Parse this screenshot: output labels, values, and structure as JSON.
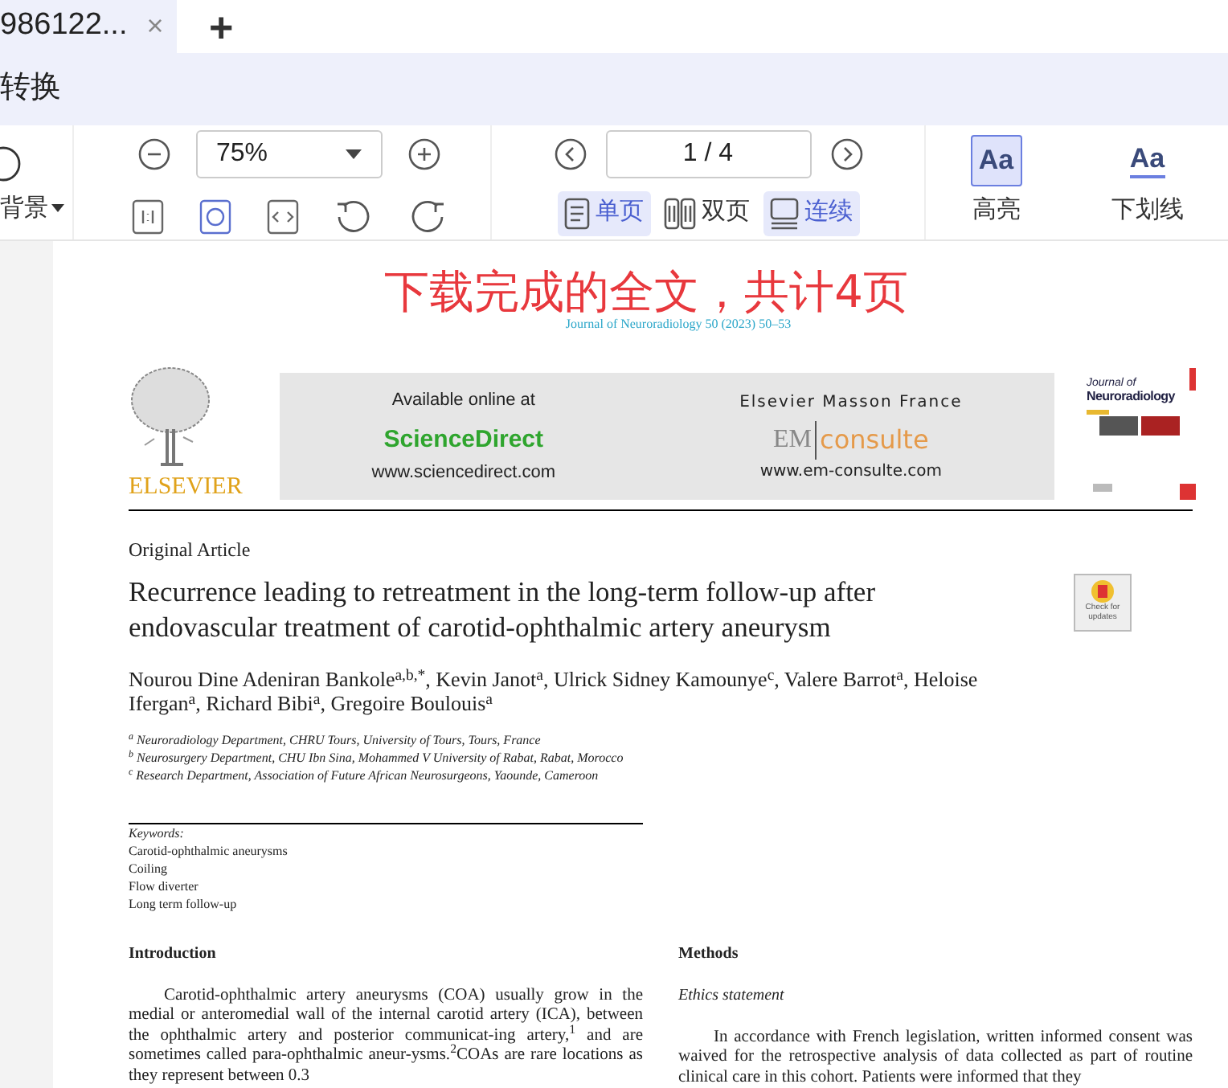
{
  "tab": {
    "title": "986122...",
    "close": "×",
    "new": "+"
  },
  "menu": {
    "items": [
      {
        "label": "转换"
      }
    ]
  },
  "toolbar": {
    "background": {
      "label": "背景"
    },
    "zoom": {
      "value": "75%"
    },
    "page": {
      "value": "1 / 4"
    },
    "views": [
      {
        "kind": "single",
        "label": "单页",
        "selected": true
      },
      {
        "kind": "double",
        "label": "双页",
        "selected": false
      },
      {
        "kind": "continuous",
        "label": "连续",
        "selected": true
      }
    ],
    "marks": [
      {
        "kind": "highlight",
        "icon_text": "Aa",
        "label": "高亮",
        "selected": true
      },
      {
        "kind": "underline",
        "icon_text": "Aa",
        "label": "下划线",
        "selected": false
      }
    ]
  },
  "document": {
    "overlay": "下载完成的全文，共计4页",
    "journal_line": "Journal of Neuroradiology 50 (2023) 50–53",
    "publisher": "ELSEVIER",
    "banner": {
      "left_heading": "Available online at",
      "left_brand": "ScienceDirect",
      "left_url": "www.sciencedirect.com",
      "right_heading": "Elsevier Masson France",
      "right_brand_a": "EM",
      "right_brand_b": "consulte",
      "right_url": "www.em-consulte.com"
    },
    "cover": {
      "line_1": "Journal of",
      "line_2": "Neuroradiology"
    },
    "article_type": "Original Article",
    "title": "Recurrence leading to retreatment in the long-term follow-up after endovascular treatment of carotid-ophthalmic artery aneurysm",
    "updates_badge": "Check for updates",
    "authors": "Nourou Dine Adeniran Bankole$^{a,b,*}$, Kevin Janot$^{a}$, Ulrick Sidney Kamounye$^{c}$, Valere Barrot$^{a}$, Heloise Ifergan$^{a}$, Richard Bibi$^{a}$, Gregoire Boulouis$^{a}$",
    "affiliations": [
      "$^{a}$ Neuroradiology Department, CHRU Tours, University of Tours, Tours, France",
      "$^{b}$ Neurosurgery Department, CHU Ibn Sina, Mohammed V University of Rabat, Rabat, Morocco",
      "$^{c}$ Research Department, Association of Future African Neurosurgeons, Yaounde, Cameroon"
    ],
    "keywords_heading": "Keywords:",
    "keywords": [
      "Carotid-ophthalmic aneurysms",
      "Coiling",
      "Flow diverter",
      "Long term follow-up"
    ],
    "introduction": {
      "heading": "Introduction",
      "text": "Carotid-ophthalmic artery aneurysms (COA) usually grow in the medial or anteromedial wall of the internal carotid artery (ICA), between the ophthalmic artery and posterior communicat-ing artery,$^{1}$ and are sometimes called para-ophthalmic aneur-ysms.$^{2}$COAs are rare locations as they represent between 0.3"
    },
    "methods": {
      "heading": "Methods",
      "subheading": "Ethics statement",
      "text": "In accordance with French legislation, written informed consent was waived for the retrospective analysis of data collected as part of routine clinical care in this cohort. Patients were informed that they"
    }
  }
}
